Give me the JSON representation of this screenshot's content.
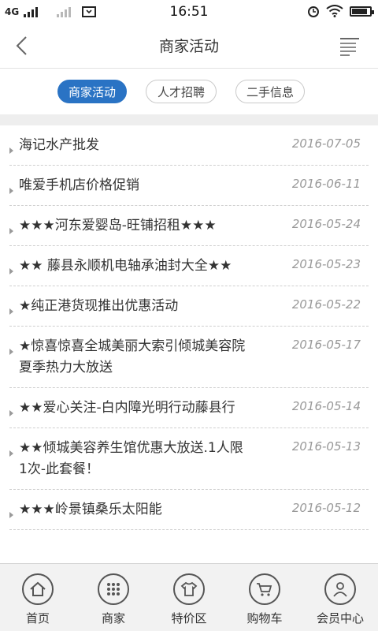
{
  "status_bar": {
    "network": "4G",
    "time": "16:51",
    "battery_level": 0.8
  },
  "header": {
    "title": "商家活动"
  },
  "tabs": [
    {
      "label": "商家活动",
      "active": true
    },
    {
      "label": "人才招聘",
      "active": false
    },
    {
      "label": "二手信息",
      "active": false
    }
  ],
  "items": [
    {
      "title": "海记水产批发",
      "date": "2016-07-05"
    },
    {
      "title": "唯爱手机店价格促销",
      "date": "2016-06-11"
    },
    {
      "title": "★★★河东爱婴岛-旺铺招租★★★",
      "date": "2016-05-24"
    },
    {
      "title": "★★ 藤县永顺机电轴承油封大全★★",
      "date": "2016-05-23"
    },
    {
      "title": "★纯正港货现推出优惠活动",
      "date": "2016-05-22"
    },
    {
      "title": "★惊喜惊喜全城美丽大索引倾城美容院夏季热力大放送",
      "date": "2016-05-17"
    },
    {
      "title": "★★爱心关注-白内障光明行动藤县行",
      "date": "2016-05-14"
    },
    {
      "title": "★★倾城美容养生馆优惠大放送.1人限1次-此套餐！",
      "date": "2016-05-13"
    },
    {
      "title": "★★★岭景镇桑乐太阳能",
      "date": "2016-05-12"
    }
  ],
  "bottom_nav": [
    {
      "label": "首页",
      "icon": "home-icon"
    },
    {
      "label": "商家",
      "icon": "grid-icon"
    },
    {
      "label": "特价区",
      "icon": "shirt-icon"
    },
    {
      "label": "购物车",
      "icon": "cart-icon"
    },
    {
      "label": "会员中心",
      "icon": "user-icon"
    }
  ]
}
